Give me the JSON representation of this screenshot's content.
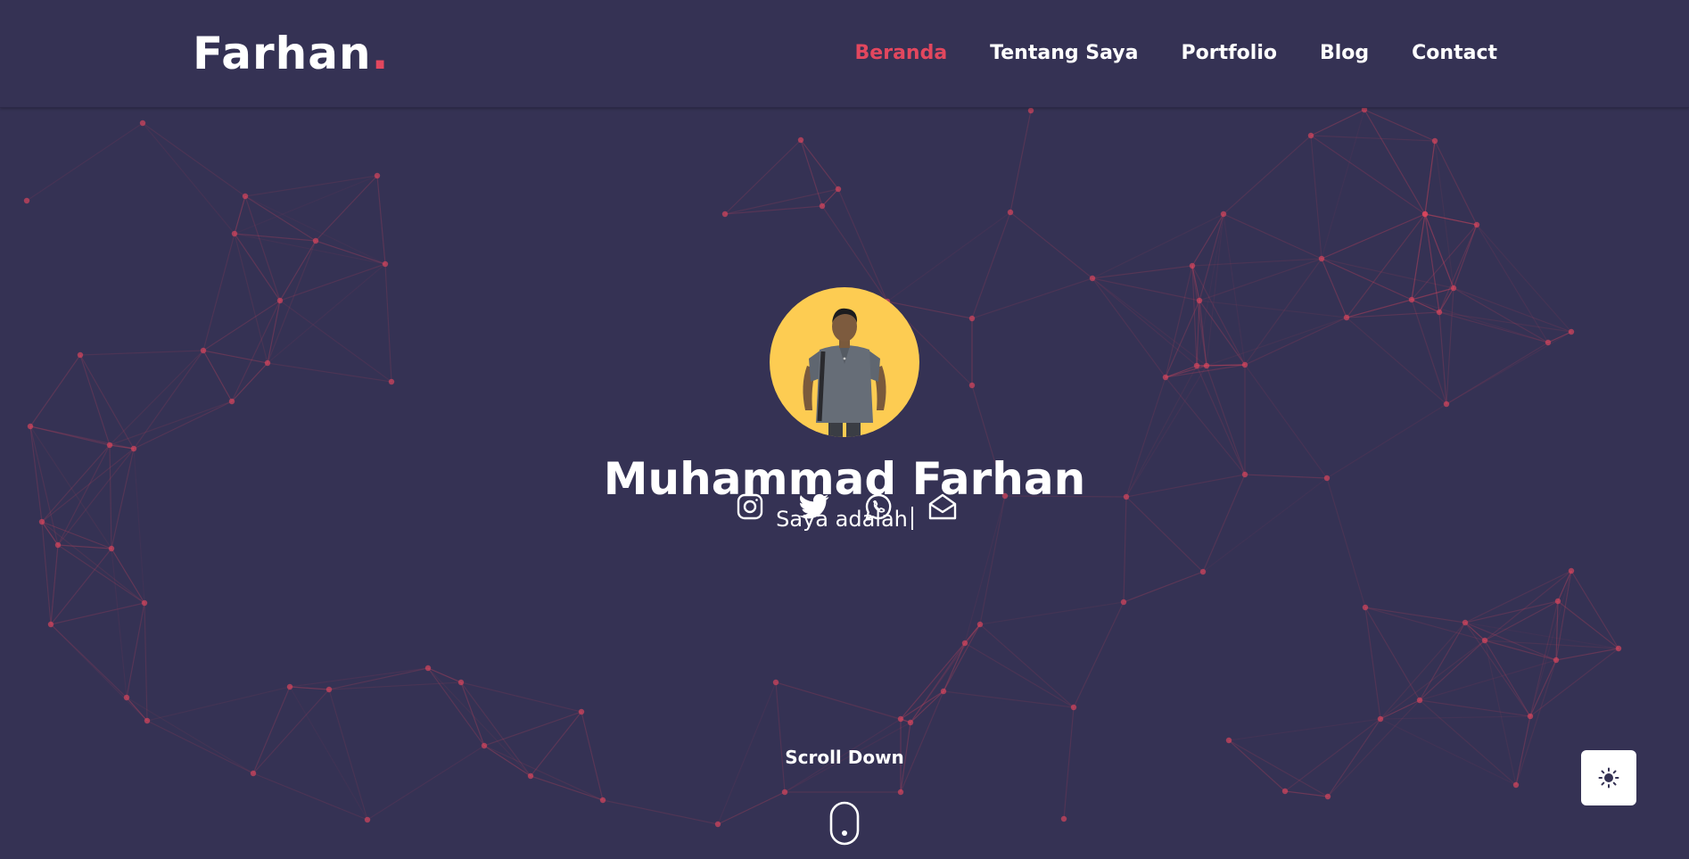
{
  "header": {
    "logo_text": "Farhan",
    "logo_dot": ".",
    "nav": [
      {
        "label": "Beranda",
        "active": true
      },
      {
        "label": "Tentang Saya",
        "active": false
      },
      {
        "label": "Portfolio",
        "active": false
      },
      {
        "label": "Blog",
        "active": false
      },
      {
        "label": "Contact",
        "active": false
      }
    ]
  },
  "hero": {
    "name": "Muhammad Farhan",
    "tagline": "Saya adalah",
    "socials": [
      "instagram-icon",
      "twitter-icon",
      "whatsapp-icon",
      "mail-icon"
    ]
  },
  "scroll": {
    "label": "Scroll Down"
  },
  "theme_toggle": {
    "icon": "sun-icon"
  },
  "colors": {
    "background": "#353254",
    "accent": "#e2475e",
    "avatar_bg": "#fdcc52",
    "text": "#ffffff"
  }
}
